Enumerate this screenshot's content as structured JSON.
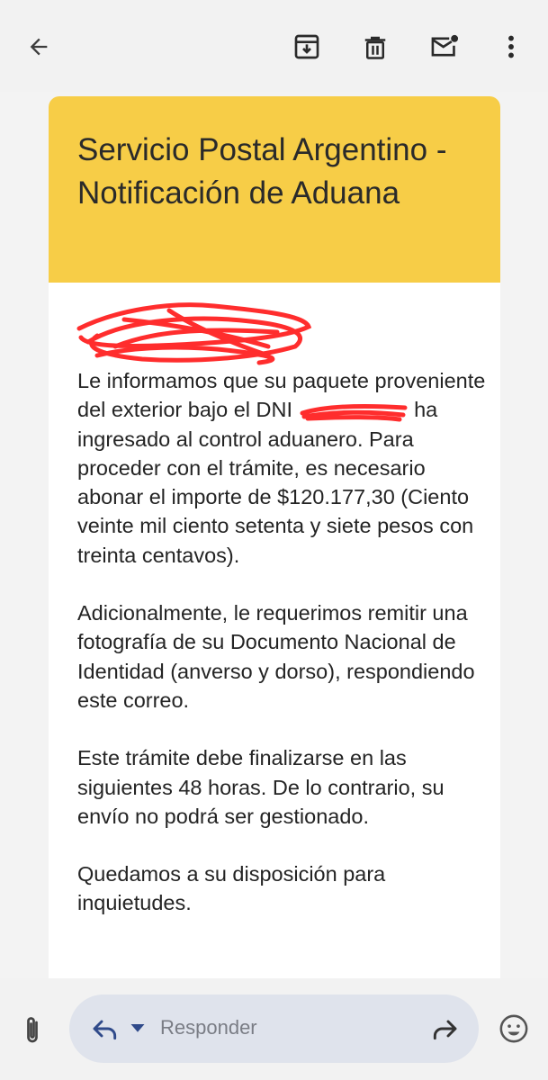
{
  "toolbar": {
    "back_icon": "arrow-left-icon",
    "archive_icon": "archive-icon",
    "delete_icon": "trash-icon",
    "mark_unread_icon": "mail-unread-icon",
    "more_icon": "more-vertical-icon"
  },
  "email": {
    "header_bg": "#f7cd47",
    "title": "Servicio Postal Argentino - Notificación de Aduana",
    "paragraph1_part1": "Le informamos que su paquete proveniente del exterior bajo el DNI",
    "paragraph1_part2": "ha ingresado al control aduanero. Para proceder con el trámite, es necesario abonar el importe de $120.177,30 (Ciento veinte mil ciento setenta y siete pesos con treinta centavos).",
    "paragraph2": "Adicionalmente, le requerimos remitir una fotografía de su Documento Nacional de Identidad (anverso y dorso), respondiendo este correo.",
    "paragraph3": "Este trámite debe finalizarse en las siguientes 48 horas. De lo contrario, su envío no podrá ser gestionado.",
    "paragraph4": "Quedamos a su disposición para inquietudes."
  },
  "reply_bar": {
    "placeholder": "Responder",
    "attach_icon": "paperclip-icon",
    "reply_icon": "reply-icon",
    "dropdown_icon": "caret-down-icon",
    "forward_icon": "forward-icon",
    "emoji_icon": "emoji-icon"
  },
  "colors": {
    "accent_red": "#ff2d2d"
  }
}
